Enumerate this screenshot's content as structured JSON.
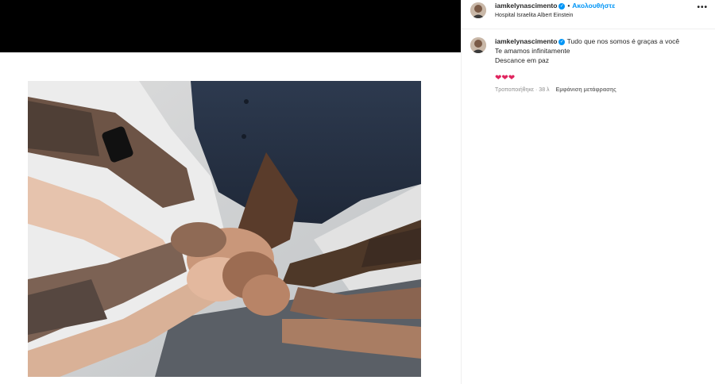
{
  "post": {
    "username": "iamkelynascimento",
    "verified_mark": "✓",
    "separator": "•",
    "follow_label": "Ακολουθήστε",
    "location": "Hospital Israelita Albert Einstein",
    "more_label": "•••",
    "avatar_icon": "profile-photo"
  },
  "caption": {
    "username": "iamkelynascimento",
    "verified_mark": "✓",
    "line1": "Tudo que nos somos é graças a você",
    "line2": "Te amamos infinitamente",
    "line3": "Descance em paz",
    "hearts": "❤❤❤",
    "edited_label": "Τροποποιήθηκε",
    "time_sep": " · ",
    "time_ago": "38 λ",
    "see_translation": "Εμφάνιση μετάφρασης"
  },
  "media": {
    "description_icon": "photo-of-hands",
    "colors": {
      "accent": "#0095f6",
      "heart": "#e0245e"
    }
  }
}
